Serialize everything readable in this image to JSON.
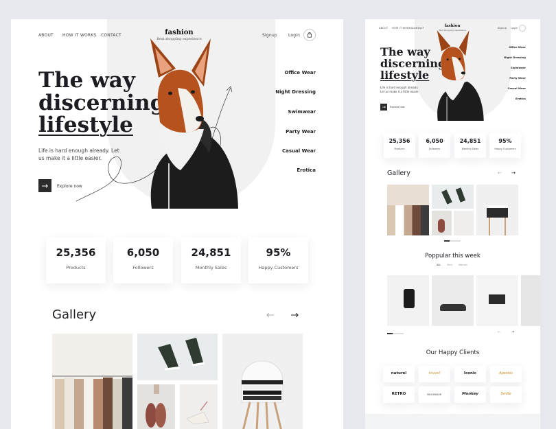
{
  "main": {
    "nav": {
      "about": "ABOUT",
      "how": "HOW IT WORKS",
      "contact": "CONTACT",
      "signup": "Signup",
      "login": "Login"
    },
    "logo": {
      "title": "fashion",
      "subtitle": "Best shopping experience"
    },
    "hero": {
      "title_line1": "The way",
      "title_line2": "discerning",
      "title_line3": "lifestyle",
      "text": "Life is hard enough already. Let us make it a little easier.",
      "cta": "Explore now"
    },
    "categories": [
      "Office Wear",
      "Night Dressing",
      "Swimwear",
      "Party Wear",
      "Casual Wear",
      "Erotica"
    ],
    "stats": [
      {
        "value": "25,356",
        "label": "Products"
      },
      {
        "value": "6,050",
        "label": "Followers"
      },
      {
        "value": "24,851",
        "label": "Monthly Sales"
      },
      {
        "value": "95%",
        "label": "Happy Customers"
      }
    ],
    "gallery_title": "Gallery"
  },
  "side": {
    "nav": {
      "about": "ABOUT",
      "how": "HOW IT WORKS",
      "contact": "CONTACT",
      "signup": "Signup",
      "login": "Login"
    },
    "logo": {
      "title": "fashion",
      "subtitle": "Best shopping experience"
    },
    "hero": {
      "title_line1": "The way",
      "title_line2": "discerning",
      "title_line3": "lifestyle",
      "text": "Life is hard enough already. Let us make it a little easier.",
      "cta": "Explore now"
    },
    "categories": [
      "Office Wear",
      "Night Dressing",
      "Swimwear",
      "Party Wear",
      "Casual Wear",
      "Erotica"
    ],
    "stats": [
      {
        "value": "25,356",
        "label": "Products"
      },
      {
        "value": "6,050",
        "label": "Followers"
      },
      {
        "value": "24,851",
        "label": "Monthly Sales"
      },
      {
        "value": "95%",
        "label": "Happy Customers"
      }
    ],
    "gallery_title": "Gallery",
    "popular_title": "Poppular this week",
    "popular_tabs": [
      "ALL",
      "Men",
      "Women"
    ],
    "clients_title": "Our Happy Clients",
    "clients": [
      "naturel",
      "travel",
      "Iconic",
      "Apestos",
      "RETRO",
      "BIGGWAVE",
      "Monkey",
      "Smile"
    ]
  },
  "colors": {
    "bg": "#e6e8ee",
    "accent_dark": "#2b2b2b",
    "panel": "#f2f2f2"
  }
}
